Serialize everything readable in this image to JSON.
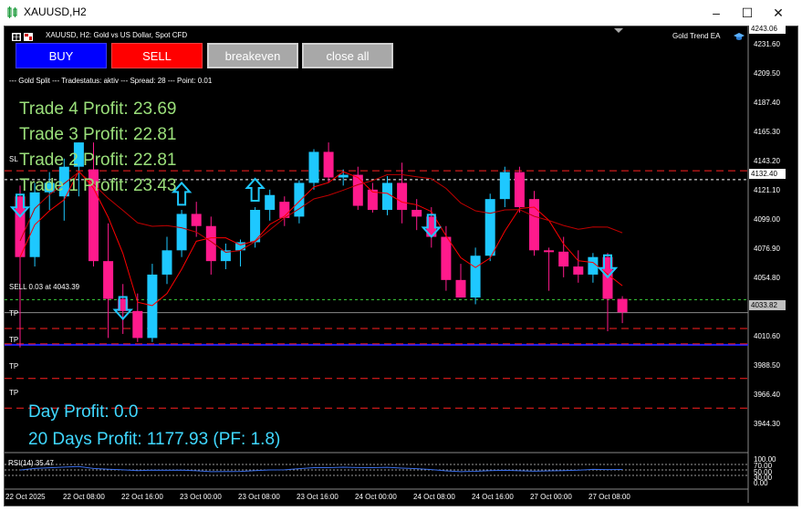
{
  "window": {
    "title": "XAUUSD,H2",
    "controls": [
      "–",
      "☐",
      "✕"
    ]
  },
  "chart_header": {
    "symbol_line": "XAUUSD, H2:  Gold vs US Dollar, Spot CFD",
    "ea_name": "Gold Trend EA"
  },
  "buttons": {
    "buy": "BUY",
    "sell": "SELL",
    "breakeven": "breakeven",
    "close_all": "close all"
  },
  "status_line": "--- Gold Split --- Tradestatus: aktiv --- Spread: 28 --- Point: 0.01",
  "trades": [
    "Trade 4 Profit: 23.69",
    "Trade 3 Profit: 22.81",
    "Trade 2 Profit: 22.81",
    "Trade 1 Profit: 23.43"
  ],
  "day_profit": "Day Profit: 0.0",
  "days20_profit": "20 Days Profit: 1177.93 (PF: 1.8)",
  "line_labels": {
    "sl": "SL",
    "sell_order": "SELL 0.03 at 4043.39",
    "tp1": "TP",
    "tp2": "TP",
    "tp3": "TP",
    "tp4": "TP"
  },
  "price_axis": [
    "4243.06",
    "4231.60",
    "4209.50",
    "4187.40",
    "4165.30",
    "4143.20",
    "4121.10",
    "4099.00",
    "4076.90",
    "4054.80",
    "4010.60",
    "3988.50",
    "3966.40",
    "3944.30"
  ],
  "price_tags": {
    "sl_price": "4132.40",
    "current_price": "4033.82"
  },
  "rsi": {
    "label": "RSI(14) 35.47",
    "levels": [
      "100.00",
      "70.00",
      "50.00",
      "30.00",
      "0.00"
    ]
  },
  "time_axis": [
    "22 Oct 2025",
    "22 Oct 08:00",
    "22 Oct 16:00",
    "23 Oct 00:00",
    "23 Oct 08:00",
    "23 Oct 16:00",
    "24 Oct 00:00",
    "24 Oct 08:00",
    "24 Oct 16:00",
    "27 Oct 00:00",
    "27 Oct 08:00"
  ],
  "colors": {
    "bull": "#1ec8ff",
    "bear": "#ff1a8c",
    "ma": "#ff0000",
    "trade_text": "#9adf7a",
    "profit_text": "#40d8ff"
  },
  "chart_data": {
    "type": "candlestick",
    "timeframe": "H2",
    "candles": [
      {
        "o": 4120,
        "h": 4128,
        "l": 4008,
        "c": 4075
      },
      {
        "o": 4075,
        "h": 4130,
        "l": 4068,
        "c": 4123
      },
      {
        "o": 4123,
        "h": 4138,
        "l": 4110,
        "c": 4130
      },
      {
        "o": 4120,
        "h": 4148,
        "l": 4102,
        "c": 4142
      },
      {
        "o": 4142,
        "h": 4160,
        "l": 4120,
        "c": 4160
      },
      {
        "o": 4140,
        "h": 4160,
        "l": 4068,
        "c": 4072
      },
      {
        "o": 4072,
        "h": 4100,
        "l": 4015,
        "c": 4044
      },
      {
        "o": 4044,
        "h": 4055,
        "l": 4018,
        "c": 4035
      },
      {
        "o": 4035,
        "h": 4048,
        "l": 4012,
        "c": 4015
      },
      {
        "o": 4015,
        "h": 4070,
        "l": 4012,
        "c": 4062
      },
      {
        "o": 4062,
        "h": 4090,
        "l": 4055,
        "c": 4080
      },
      {
        "o": 4080,
        "h": 4110,
        "l": 4075,
        "c": 4107
      },
      {
        "o": 4107,
        "h": 4116,
        "l": 4090,
        "c": 4098
      },
      {
        "o": 4098,
        "h": 4105,
        "l": 4062,
        "c": 4072
      },
      {
        "o": 4072,
        "h": 4085,
        "l": 4066,
        "c": 4080
      },
      {
        "o": 4080,
        "h": 4088,
        "l": 4068,
        "c": 4086
      },
      {
        "o": 4086,
        "h": 4112,
        "l": 4082,
        "c": 4110
      },
      {
        "o": 4110,
        "h": 4125,
        "l": 4102,
        "c": 4121
      },
      {
        "o": 4116,
        "h": 4120,
        "l": 4098,
        "c": 4104
      },
      {
        "o": 4105,
        "h": 4132,
        "l": 4100,
        "c": 4130
      },
      {
        "o": 4130,
        "h": 4155,
        "l": 4125,
        "c": 4153
      },
      {
        "o": 4153,
        "h": 4160,
        "l": 4130,
        "c": 4134
      },
      {
        "o": 4134,
        "h": 4140,
        "l": 4128,
        "c": 4136
      },
      {
        "o": 4136,
        "h": 4142,
        "l": 4110,
        "c": 4113
      },
      {
        "o": 4125,
        "h": 4130,
        "l": 4108,
        "c": 4110
      },
      {
        "o": 4110,
        "h": 4135,
        "l": 4106,
        "c": 4130
      },
      {
        "o": 4130,
        "h": 4145,
        "l": 4100,
        "c": 4110
      },
      {
        "o": 4110,
        "h": 4118,
        "l": 4095,
        "c": 4105
      },
      {
        "o": 4105,
        "h": 4112,
        "l": 4082,
        "c": 4090
      },
      {
        "o": 4090,
        "h": 4098,
        "l": 4050,
        "c": 4058
      },
      {
        "o": 4058,
        "h": 4070,
        "l": 4045,
        "c": 4045
      },
      {
        "o": 4045,
        "h": 4082,
        "l": 4040,
        "c": 4076
      },
      {
        "o": 4076,
        "h": 4122,
        "l": 4072,
        "c": 4118
      },
      {
        "o": 4118,
        "h": 4142,
        "l": 4112,
        "c": 4138
      },
      {
        "o": 4138,
        "h": 4142,
        "l": 4108,
        "c": 4112
      },
      {
        "o": 4118,
        "h": 4124,
        "l": 4076,
        "c": 4080
      },
      {
        "o": 4080,
        "h": 4082,
        "l": 4050,
        "c": 4079
      },
      {
        "o": 4079,
        "h": 4090,
        "l": 4060,
        "c": 4068
      },
      {
        "o": 4068,
        "h": 4080,
        "l": 4056,
        "c": 4062
      },
      {
        "o": 4062,
        "h": 4078,
        "l": 4056,
        "c": 4075
      },
      {
        "o": 4075,
        "h": 4078,
        "l": 4020,
        "c": 4044
      },
      {
        "o": 4044,
        "h": 4046,
        "l": 4026,
        "c": 4034
      }
    ],
    "levels": {
      "sl": 4132.4,
      "entry": 4043.39,
      "current": 4033.82,
      "tp": [
        4022.0,
        4010.6,
        3985.0,
        3963.0
      ]
    },
    "ylim": [
      3930,
      4246
    ],
    "arrows": [
      {
        "i": 0,
        "dir": "down"
      },
      {
        "i": 7,
        "dir": "down"
      },
      {
        "i": 11,
        "dir": "up"
      },
      {
        "i": 16,
        "dir": "up"
      },
      {
        "i": 28,
        "dir": "down"
      },
      {
        "i": 40,
        "dir": "down"
      }
    ],
    "rsi_value": 35.47
  }
}
